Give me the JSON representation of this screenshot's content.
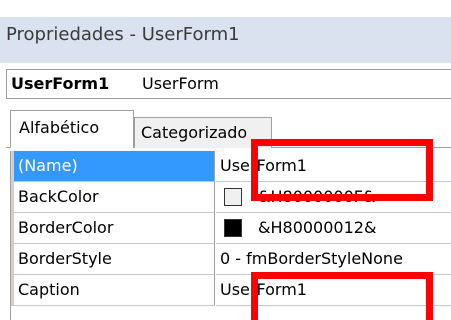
{
  "window": {
    "title": "Propriedades - UserForm1"
  },
  "object_selector": {
    "name": "UserForm1",
    "type": "UserForm"
  },
  "tabs": [
    {
      "label": "Alfabético",
      "active": true
    },
    {
      "label": "Categorizado",
      "active": false
    }
  ],
  "properties": [
    {
      "name": "(Name)",
      "value": "UserForm1",
      "selected": true
    },
    {
      "name": "BackColor",
      "value": "&H8000000F&",
      "swatch": "#f0f0f0"
    },
    {
      "name": "BorderColor",
      "value": "&H80000012&",
      "swatch": "#000000"
    },
    {
      "name": "BorderStyle",
      "value": "0 - fmBorderStyleNone"
    },
    {
      "name": "Caption",
      "value": "UserForm1"
    }
  ],
  "colors": {
    "selection": "#3399ff",
    "highlight_box": "#ff0000",
    "title_bar": "#d9e2ee"
  }
}
